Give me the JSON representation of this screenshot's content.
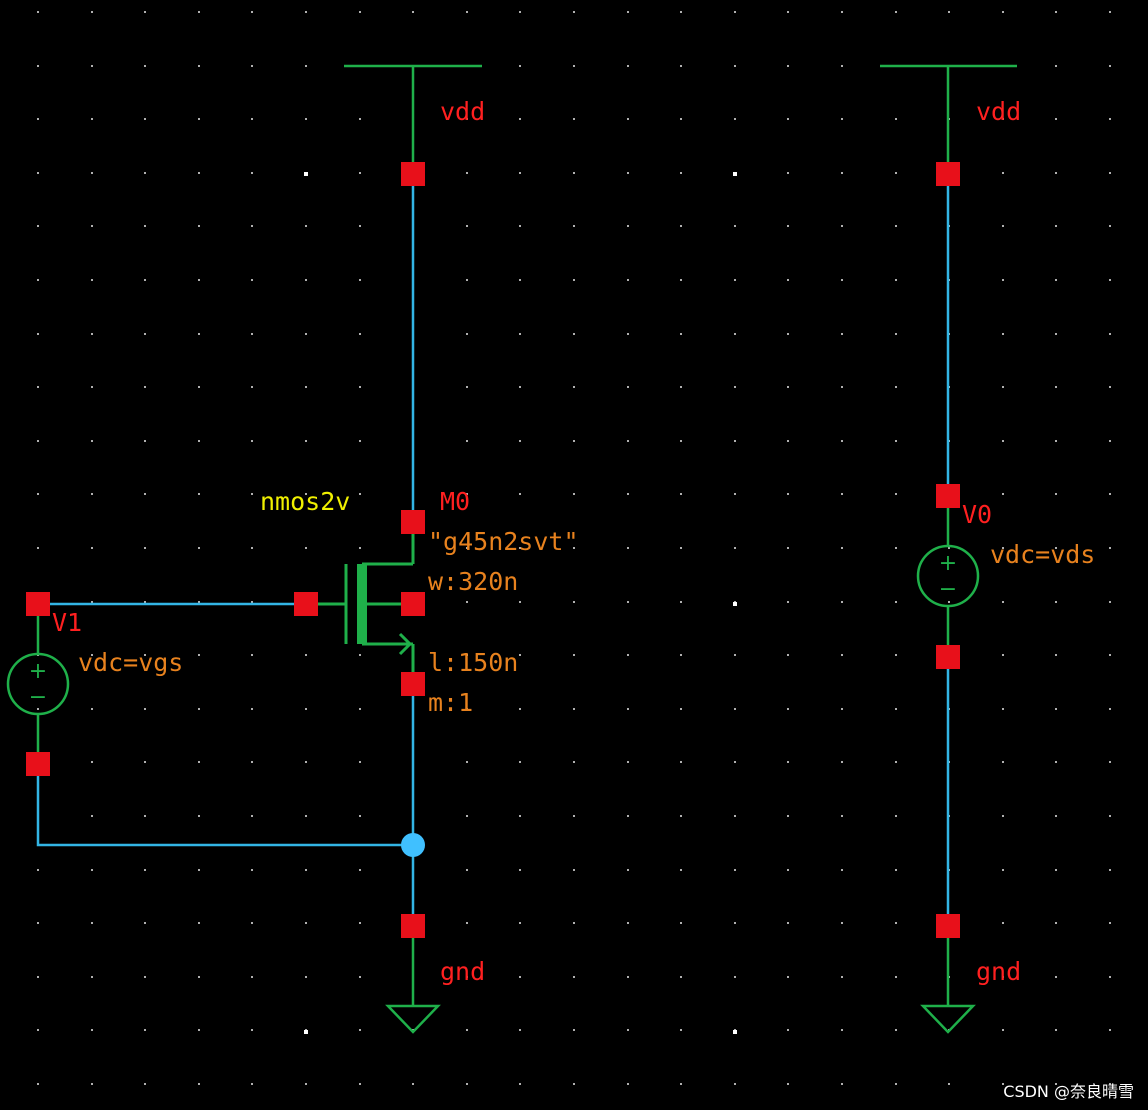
{
  "colors": {
    "background": "#000000",
    "wire": "#33b5e5",
    "symbol": "#1fb04a",
    "pin": "#e8101a",
    "label_red": "#ff2020",
    "label_orange": "#e8821e",
    "label_yellow": "#f0f000",
    "junction": "#40c0ff",
    "grid_dot": "#b0b0b0"
  },
  "left": {
    "vdd_label": "vdd",
    "gnd_label": "gnd",
    "transistor": {
      "cell": "nmos2v",
      "instance": "M0",
      "model": "\"g45n2svt\"",
      "width": "w:320n",
      "length": "l:150n",
      "mult": "m:1"
    },
    "source": {
      "instance": "V1",
      "value": "vdc=vgs",
      "plus": "+",
      "minus": "−"
    }
  },
  "right": {
    "vdd_label": "vdd",
    "gnd_label": "gnd",
    "source": {
      "instance": "V0",
      "value": "vdc=vds",
      "plus": "+",
      "minus": "−"
    }
  },
  "watermark": "CSDN @奈良晴雪"
}
